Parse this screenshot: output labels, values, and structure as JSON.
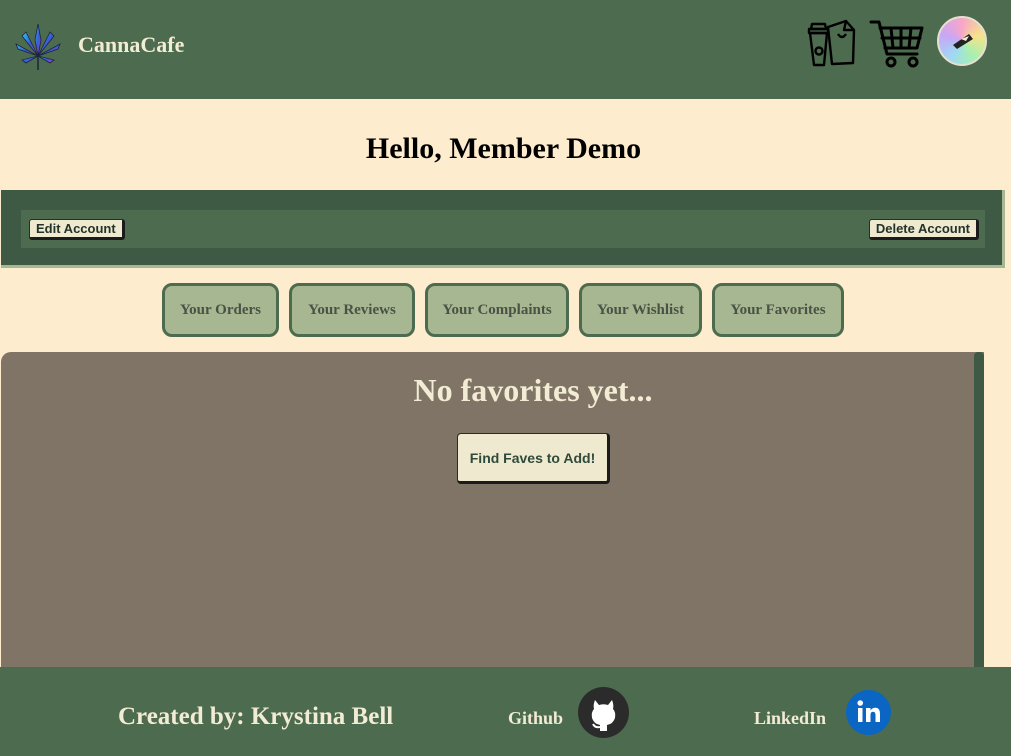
{
  "header": {
    "brand": "CannaCafe"
  },
  "greeting": "Hello, Member Demo",
  "account": {
    "edit_label": "Edit Account",
    "delete_label": "Delete Account"
  },
  "tabs": [
    {
      "label": "Your Orders"
    },
    {
      "label": "Your Reviews"
    },
    {
      "label": "Your Complaints"
    },
    {
      "label": "Your Wishlist"
    },
    {
      "label": "Your Favorites"
    }
  ],
  "content": {
    "empty_message": "No favorites yet...",
    "action_label": "Find Faves to Add!"
  },
  "footer": {
    "credit": "Created by: Krystina Bell",
    "github_label": "Github",
    "linkedin_label": "LinkedIn"
  },
  "colors": {
    "header_bg": "#4d6b4f",
    "page_bg": "#feecce",
    "tab_bg": "#a7b791",
    "panel_bg": "#7f7465",
    "button_bg": "#efe9cf"
  },
  "icons": {
    "logo": "cannabis-leaf-icon",
    "orders": "shopping-bag-coffee-icon",
    "cart": "shopping-cart-icon",
    "avatar": "user-avatar",
    "github": "github-icon",
    "linkedin": "linkedin-icon"
  }
}
